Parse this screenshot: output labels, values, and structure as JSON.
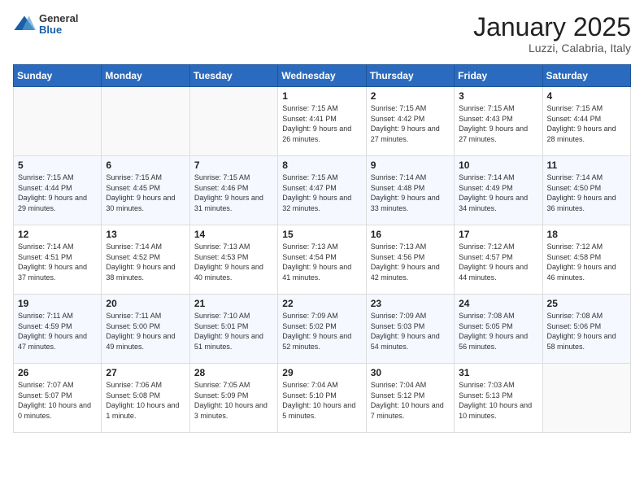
{
  "logo": {
    "general": "General",
    "blue": "Blue"
  },
  "header": {
    "title": "January 2025",
    "location": "Luzzi, Calabria, Italy"
  },
  "weekdays": [
    "Sunday",
    "Monday",
    "Tuesday",
    "Wednesday",
    "Thursday",
    "Friday",
    "Saturday"
  ],
  "weeks": [
    [
      {
        "day": "",
        "info": ""
      },
      {
        "day": "",
        "info": ""
      },
      {
        "day": "",
        "info": ""
      },
      {
        "day": "1",
        "info": "Sunrise: 7:15 AM\nSunset: 4:41 PM\nDaylight: 9 hours and 26 minutes."
      },
      {
        "day": "2",
        "info": "Sunrise: 7:15 AM\nSunset: 4:42 PM\nDaylight: 9 hours and 27 minutes."
      },
      {
        "day": "3",
        "info": "Sunrise: 7:15 AM\nSunset: 4:43 PM\nDaylight: 9 hours and 27 minutes."
      },
      {
        "day": "4",
        "info": "Sunrise: 7:15 AM\nSunset: 4:44 PM\nDaylight: 9 hours and 28 minutes."
      }
    ],
    [
      {
        "day": "5",
        "info": "Sunrise: 7:15 AM\nSunset: 4:44 PM\nDaylight: 9 hours and 29 minutes."
      },
      {
        "day": "6",
        "info": "Sunrise: 7:15 AM\nSunset: 4:45 PM\nDaylight: 9 hours and 30 minutes."
      },
      {
        "day": "7",
        "info": "Sunrise: 7:15 AM\nSunset: 4:46 PM\nDaylight: 9 hours and 31 minutes."
      },
      {
        "day": "8",
        "info": "Sunrise: 7:15 AM\nSunset: 4:47 PM\nDaylight: 9 hours and 32 minutes."
      },
      {
        "day": "9",
        "info": "Sunrise: 7:14 AM\nSunset: 4:48 PM\nDaylight: 9 hours and 33 minutes."
      },
      {
        "day": "10",
        "info": "Sunrise: 7:14 AM\nSunset: 4:49 PM\nDaylight: 9 hours and 34 minutes."
      },
      {
        "day": "11",
        "info": "Sunrise: 7:14 AM\nSunset: 4:50 PM\nDaylight: 9 hours and 36 minutes."
      }
    ],
    [
      {
        "day": "12",
        "info": "Sunrise: 7:14 AM\nSunset: 4:51 PM\nDaylight: 9 hours and 37 minutes."
      },
      {
        "day": "13",
        "info": "Sunrise: 7:14 AM\nSunset: 4:52 PM\nDaylight: 9 hours and 38 minutes."
      },
      {
        "day": "14",
        "info": "Sunrise: 7:13 AM\nSunset: 4:53 PM\nDaylight: 9 hours and 40 minutes."
      },
      {
        "day": "15",
        "info": "Sunrise: 7:13 AM\nSunset: 4:54 PM\nDaylight: 9 hours and 41 minutes."
      },
      {
        "day": "16",
        "info": "Sunrise: 7:13 AM\nSunset: 4:56 PM\nDaylight: 9 hours and 42 minutes."
      },
      {
        "day": "17",
        "info": "Sunrise: 7:12 AM\nSunset: 4:57 PM\nDaylight: 9 hours and 44 minutes."
      },
      {
        "day": "18",
        "info": "Sunrise: 7:12 AM\nSunset: 4:58 PM\nDaylight: 9 hours and 46 minutes."
      }
    ],
    [
      {
        "day": "19",
        "info": "Sunrise: 7:11 AM\nSunset: 4:59 PM\nDaylight: 9 hours and 47 minutes."
      },
      {
        "day": "20",
        "info": "Sunrise: 7:11 AM\nSunset: 5:00 PM\nDaylight: 9 hours and 49 minutes."
      },
      {
        "day": "21",
        "info": "Sunrise: 7:10 AM\nSunset: 5:01 PM\nDaylight: 9 hours and 51 minutes."
      },
      {
        "day": "22",
        "info": "Sunrise: 7:09 AM\nSunset: 5:02 PM\nDaylight: 9 hours and 52 minutes."
      },
      {
        "day": "23",
        "info": "Sunrise: 7:09 AM\nSunset: 5:03 PM\nDaylight: 9 hours and 54 minutes."
      },
      {
        "day": "24",
        "info": "Sunrise: 7:08 AM\nSunset: 5:05 PM\nDaylight: 9 hours and 56 minutes."
      },
      {
        "day": "25",
        "info": "Sunrise: 7:08 AM\nSunset: 5:06 PM\nDaylight: 9 hours and 58 minutes."
      }
    ],
    [
      {
        "day": "26",
        "info": "Sunrise: 7:07 AM\nSunset: 5:07 PM\nDaylight: 10 hours and 0 minutes."
      },
      {
        "day": "27",
        "info": "Sunrise: 7:06 AM\nSunset: 5:08 PM\nDaylight: 10 hours and 1 minute."
      },
      {
        "day": "28",
        "info": "Sunrise: 7:05 AM\nSunset: 5:09 PM\nDaylight: 10 hours and 3 minutes."
      },
      {
        "day": "29",
        "info": "Sunrise: 7:04 AM\nSunset: 5:10 PM\nDaylight: 10 hours and 5 minutes."
      },
      {
        "day": "30",
        "info": "Sunrise: 7:04 AM\nSunset: 5:12 PM\nDaylight: 10 hours and 7 minutes."
      },
      {
        "day": "31",
        "info": "Sunrise: 7:03 AM\nSunset: 5:13 PM\nDaylight: 10 hours and 10 minutes."
      },
      {
        "day": "",
        "info": ""
      }
    ]
  ]
}
